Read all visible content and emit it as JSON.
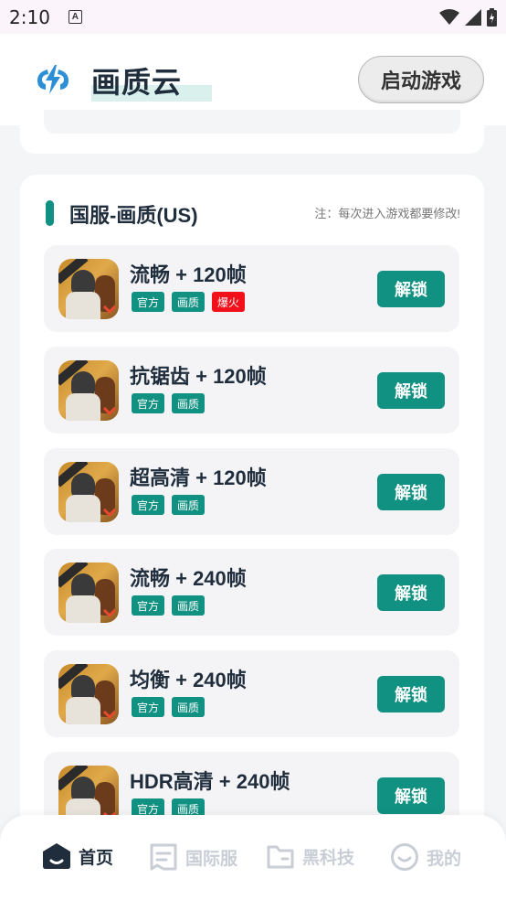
{
  "status_bar": {
    "time": "2:10"
  },
  "header": {
    "app_title": "画质云",
    "launch_button": "启动游戏"
  },
  "section": {
    "title": "国服-画质(US)",
    "note": "注：每次进入游戏都要修改!"
  },
  "items": [
    {
      "title": "流畅 + 120帧",
      "tags": [
        "官方",
        "画质",
        "爆火"
      ],
      "button": "解锁"
    },
    {
      "title": "抗锯齿 + 120帧",
      "tags": [
        "官方",
        "画质"
      ],
      "button": "解锁"
    },
    {
      "title": "超高清 + 120帧",
      "tags": [
        "官方",
        "画质"
      ],
      "button": "解锁"
    },
    {
      "title": "流畅 + 240帧",
      "tags": [
        "官方",
        "画质"
      ],
      "button": "解锁"
    },
    {
      "title": "均衡 + 240帧",
      "tags": [
        "官方",
        "画质"
      ],
      "button": "解锁"
    },
    {
      "title": "HDR高清 + 240帧",
      "tags": [
        "官方",
        "画质"
      ],
      "button": "解锁"
    }
  ],
  "nav": [
    {
      "label": "首页",
      "icon": "home-icon",
      "active": true
    },
    {
      "label": "国际服",
      "icon": "document-icon",
      "active": false
    },
    {
      "label": "黑科技",
      "icon": "folder-icon",
      "active": false
    },
    {
      "label": "我的",
      "icon": "smile-icon",
      "active": false
    }
  ],
  "colors": {
    "accent": "#109181",
    "hot": "#f2101a",
    "logo": "#2d8fd5",
    "nav_inactive": "#c9ced6"
  }
}
